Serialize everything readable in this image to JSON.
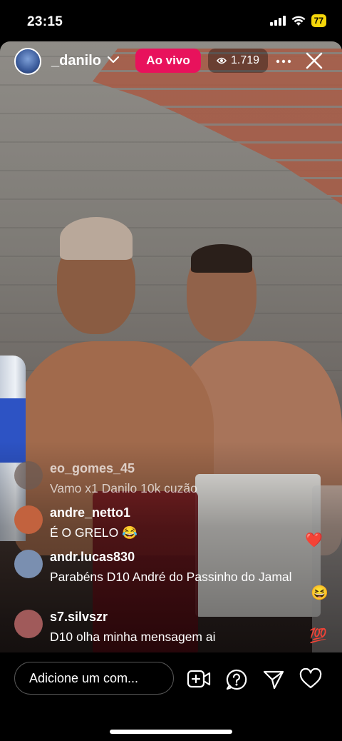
{
  "status": {
    "time": "23:15",
    "battery": "77"
  },
  "live": {
    "host_username": "_danilo",
    "live_label": "Ao vivo",
    "viewer_count": "1.719"
  },
  "comments": [
    {
      "user": "eo_gomes_45",
      "text": "Vamo x1 Danilo 10k cuzão",
      "avatar_color": "#6b5b55"
    },
    {
      "user": "andre_netto1",
      "text": "É O GRELO 😂",
      "avatar_color": "#c2623e"
    },
    {
      "user": "andr.lucas830",
      "text": "Parabéns D10 André do Passinho do Jamal",
      "avatar_color": "#7a8fb0"
    },
    {
      "user": "s7.silvszr",
      "text": "D10 olha minha mensagem ai",
      "avatar_color": "#a05a5a"
    }
  ],
  "floating_reactions": [
    "❤️",
    "😆",
    "💯"
  ],
  "bottom": {
    "comment_placeholder": "Adicione um com..."
  },
  "icons": [
    "signal-icon",
    "wifi-icon",
    "battery-icon",
    "chevron-down-icon",
    "eye-icon",
    "more-icon",
    "close-icon",
    "add-video-icon",
    "question-icon",
    "send-icon",
    "heart-icon"
  ]
}
